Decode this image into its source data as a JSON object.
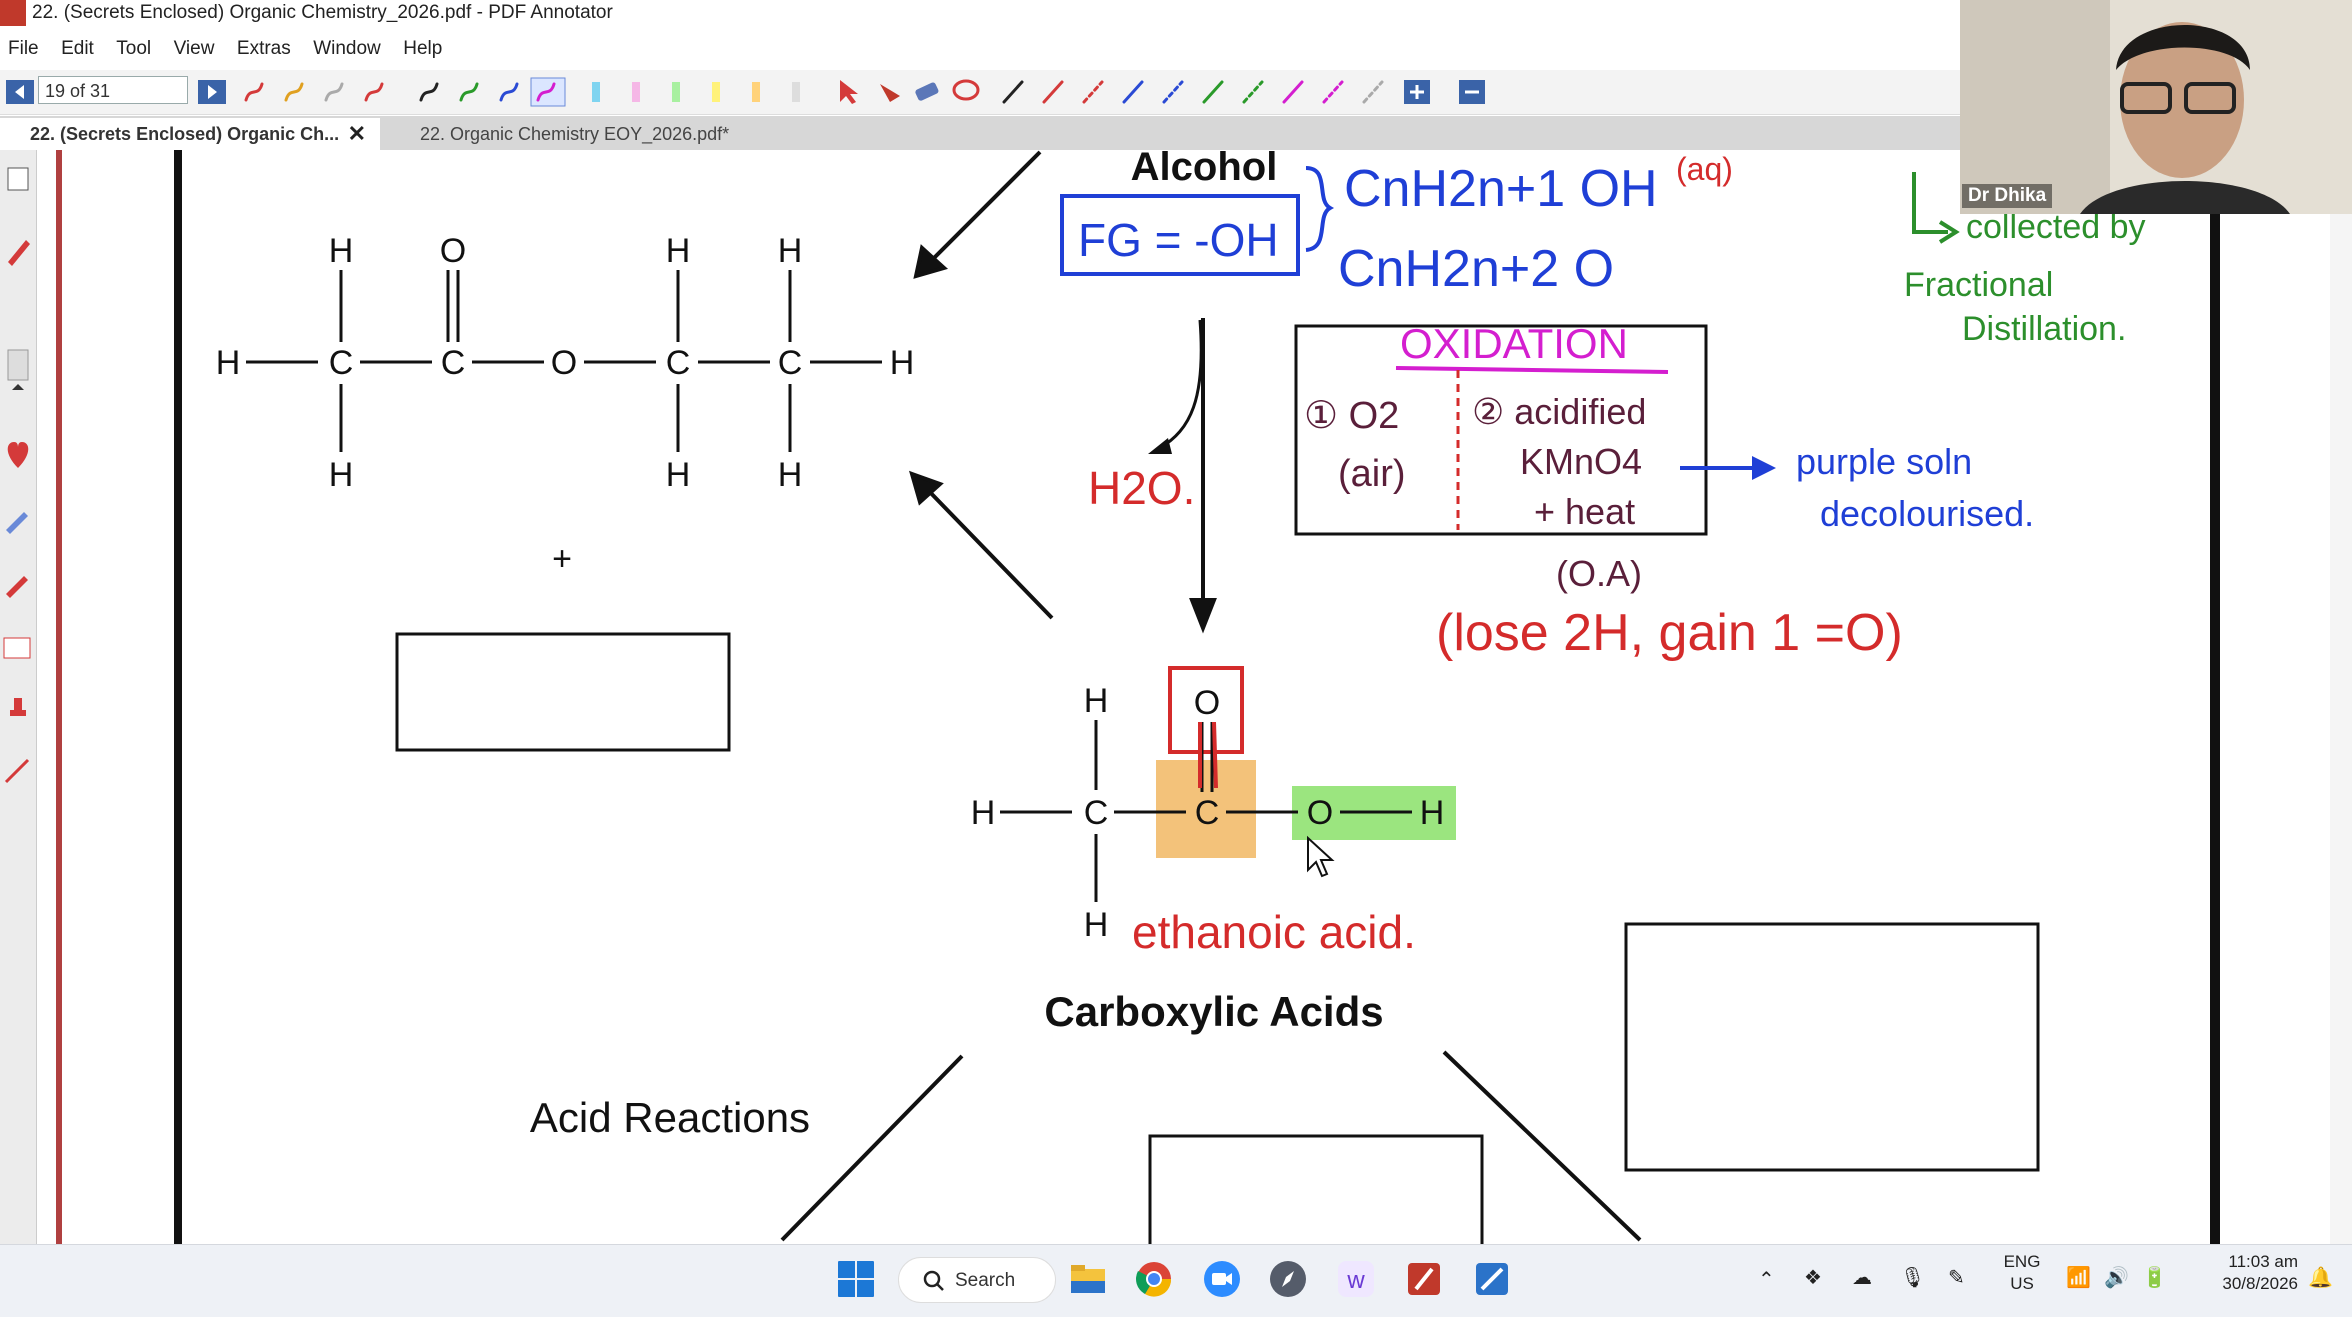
{
  "window": {
    "title": "22. (Secrets Enclosed) Organic Chemistry_2026.pdf - PDF Annotator"
  },
  "menu": [
    "File",
    "Edit",
    "Tool",
    "View",
    "Extras",
    "Window",
    "Help"
  ],
  "toolbar": {
    "page_indicator": "19 of 31"
  },
  "tabs": [
    {
      "label": "22. (Secrets Enclosed) Organic Ch...",
      "active": true
    },
    {
      "label": "22. Organic Chemistry EOY_2026.pdf*",
      "active": false
    }
  ],
  "webcam": {
    "name": "Dr Dhika"
  },
  "slide": {
    "alcohol_title": "Alcohol",
    "carboxylic_title": "Carboxylic Acids",
    "acid_reactions": "Acid Reactions",
    "plus": "+",
    "ester_atoms": {
      "H": "H",
      "C": "C",
      "O": "O"
    },
    "handwriting": {
      "fg": "FG = -OH",
      "formula1": "CnH2n+1 OH",
      "formula2": "CnH2n+2 O",
      "aq": "(aq)",
      "collected": "collected by",
      "fractional": "Fractional",
      "distillation": "Distillation.",
      "h2o": "H2O.",
      "oxidation": "OXIDATION",
      "opt1_a": "① O2",
      "opt1_b": "(air)",
      "opt2_a": "② acidified",
      "opt2_b": "KMnO4",
      "opt2_c": "+ heat",
      "oa": "(O.A)",
      "purple1": "purple soln",
      "purple2": "decolourised.",
      "lose": "(lose 2H, gain 1 =O)",
      "ethanoic": "ethanoic acid."
    }
  },
  "taskbar": {
    "search": "Search",
    "lang1": "ENG",
    "lang2": "US",
    "time": "11:03 am",
    "date": "30/8/2026"
  },
  "colors": {
    "accent_red": "#d42b2b",
    "blue": "#1f3fd6",
    "green": "#2c8f2c",
    "magenta": "#d41ecf",
    "highlight_orange": "#f3c27a",
    "highlight_green": "#9be57f"
  }
}
